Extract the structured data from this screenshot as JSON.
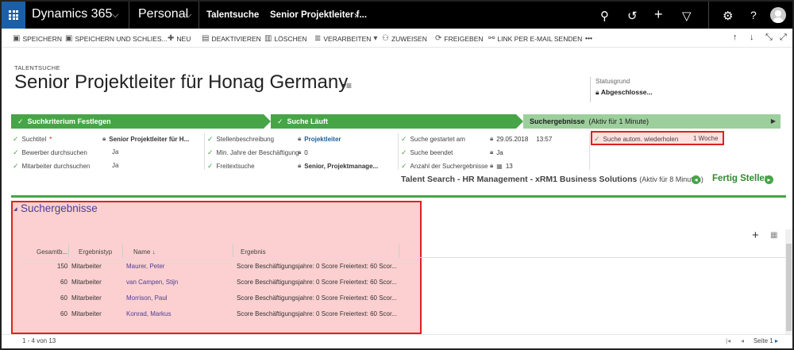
{
  "topbar": {
    "app_name": "Dynamics 365",
    "area_name": "Personal",
    "breadcrumb_1": "Talentsuche",
    "breadcrumb_2": "Senior Projektleiter f..."
  },
  "command_bar": {
    "save": "SPEICHERN",
    "save_close": "SPEICHERN UND SCHLIES...",
    "new": "NEU",
    "deactivate": "DEAKTIVIEREN",
    "delete": "LÖSCHEN",
    "process": "VERARBEITEN",
    "assign": "ZUWEISEN",
    "share": "FREIGEBEN",
    "email_link": "LINK PER E-MAIL SENDEN",
    "more": "•••"
  },
  "header": {
    "entity": "TALENTSUCHE",
    "title": "Senior Projektleiter für Honag Germany",
    "status_label": "Statusgrund",
    "status_value": "Abgeschlosse..."
  },
  "process": {
    "stages": [
      {
        "label": "Suchkriterium Festlegen",
        "sub": ""
      },
      {
        "label": "Suche Läuft",
        "sub": ""
      },
      {
        "label": "Suchergebnisse",
        "sub": "(Aktiv für 1 Minute)"
      }
    ],
    "steps": [
      {
        "label": "Suchtitel",
        "value": "Senior Projektleiter für H..."
      },
      {
        "label": "Bewerber durchsuchen",
        "value": "Ja"
      },
      {
        "label": "Mitarbeiter durchsuchen",
        "value": "Ja"
      },
      {
        "label": "Stellenbeschreibung",
        "value": "Projektleiter"
      },
      {
        "label": "Min. Jahre der Beschäftigung",
        "value": "0"
      },
      {
        "label": "Freitextsuche",
        "value": "Senior, Projektmanage..."
      },
      {
        "label": "Suche gestartet am",
        "value": "29.05.2018",
        "value2": "13:57"
      },
      {
        "label": "Suche beendet",
        "value": "Ja"
      },
      {
        "label": "Anzahl der Suchergebnisse",
        "value": "13"
      },
      {
        "label": "Suche autom. wiederholen",
        "value": "1 Woche"
      }
    ],
    "workflow_name": "Talent Search - HR Management - xRM1 Business Solutions",
    "workflow_sub": "(Aktiv für 8 Minuten)",
    "finish": "Fertig Stellen"
  },
  "results": {
    "section_title": "Suchergebnisse",
    "columns": [
      "Gesamtb...",
      "Ergebnistyp",
      "Name",
      "Ergebnis"
    ],
    "rows": [
      {
        "score": "150",
        "type": "Mitarbeiter",
        "name": "Maurer, Peter",
        "result": "Score Beschäftigungsjahre: 0 Score Freiertext: 60 Scor..."
      },
      {
        "score": "60",
        "type": "Mitarbeiter",
        "name": "van Campen, Stijn",
        "result": "Score Beschäftigungsjahre: 0 Score Freiertext: 60 Scor..."
      },
      {
        "score": "60",
        "type": "Mitarbeiter",
        "name": "Morrison, Paul",
        "result": "Score Beschäftigungsjahre: 0 Score Freiertext: 60 Scor..."
      },
      {
        "score": "60",
        "type": "Mitarbeiter",
        "name": "Konrad, Markus",
        "result": "Score Beschäftigungsjahre: 0 Score Freiertext: 60 Scor..."
      }
    ],
    "count_text": "1 - 4  von 13",
    "page_text": "Seite 1"
  }
}
